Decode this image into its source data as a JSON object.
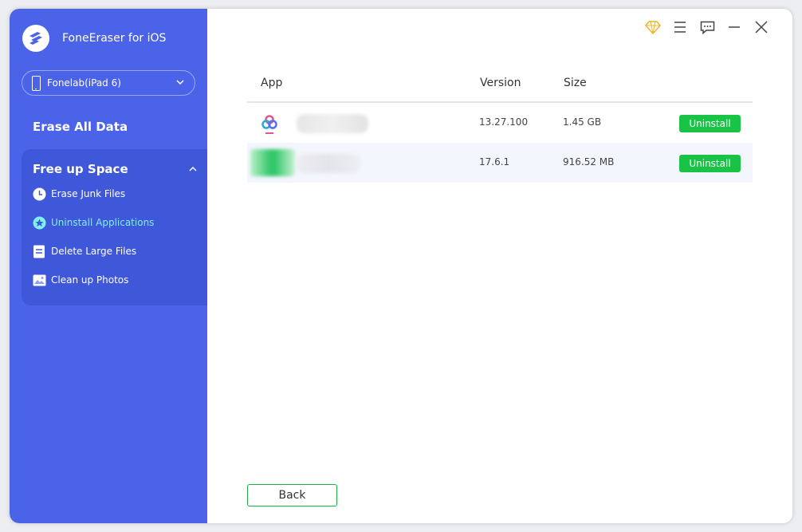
{
  "app": {
    "title": "FoneEraser for iOS"
  },
  "device": {
    "name": "Fonelab(iPad 6)"
  },
  "sidebar": {
    "erase_all": "Erase All Data",
    "section_title": "Free up Space",
    "items": [
      {
        "label": "Erase Junk Files",
        "icon": "clock-icon"
      },
      {
        "label": "Uninstall Applications",
        "icon": "app-store-icon",
        "active": true
      },
      {
        "label": "Delete Large Files",
        "icon": "document-icon"
      },
      {
        "label": "Clean up Photos",
        "icon": "photo-icon"
      }
    ]
  },
  "table": {
    "headers": {
      "app": "App",
      "version": "Version",
      "size": "Size"
    },
    "rows": [
      {
        "version": "13.27.100",
        "size": "1.45 GB",
        "action": "Uninstall"
      },
      {
        "version": "17.6.1",
        "size": "916.52 MB",
        "action": "Uninstall"
      }
    ]
  },
  "buttons": {
    "back": "Back"
  },
  "colors": {
    "sidebar": "#4a63e8",
    "active_item": "#7ff0ef",
    "uninstall": "#18c346",
    "accent_premium": "#f0b429"
  }
}
